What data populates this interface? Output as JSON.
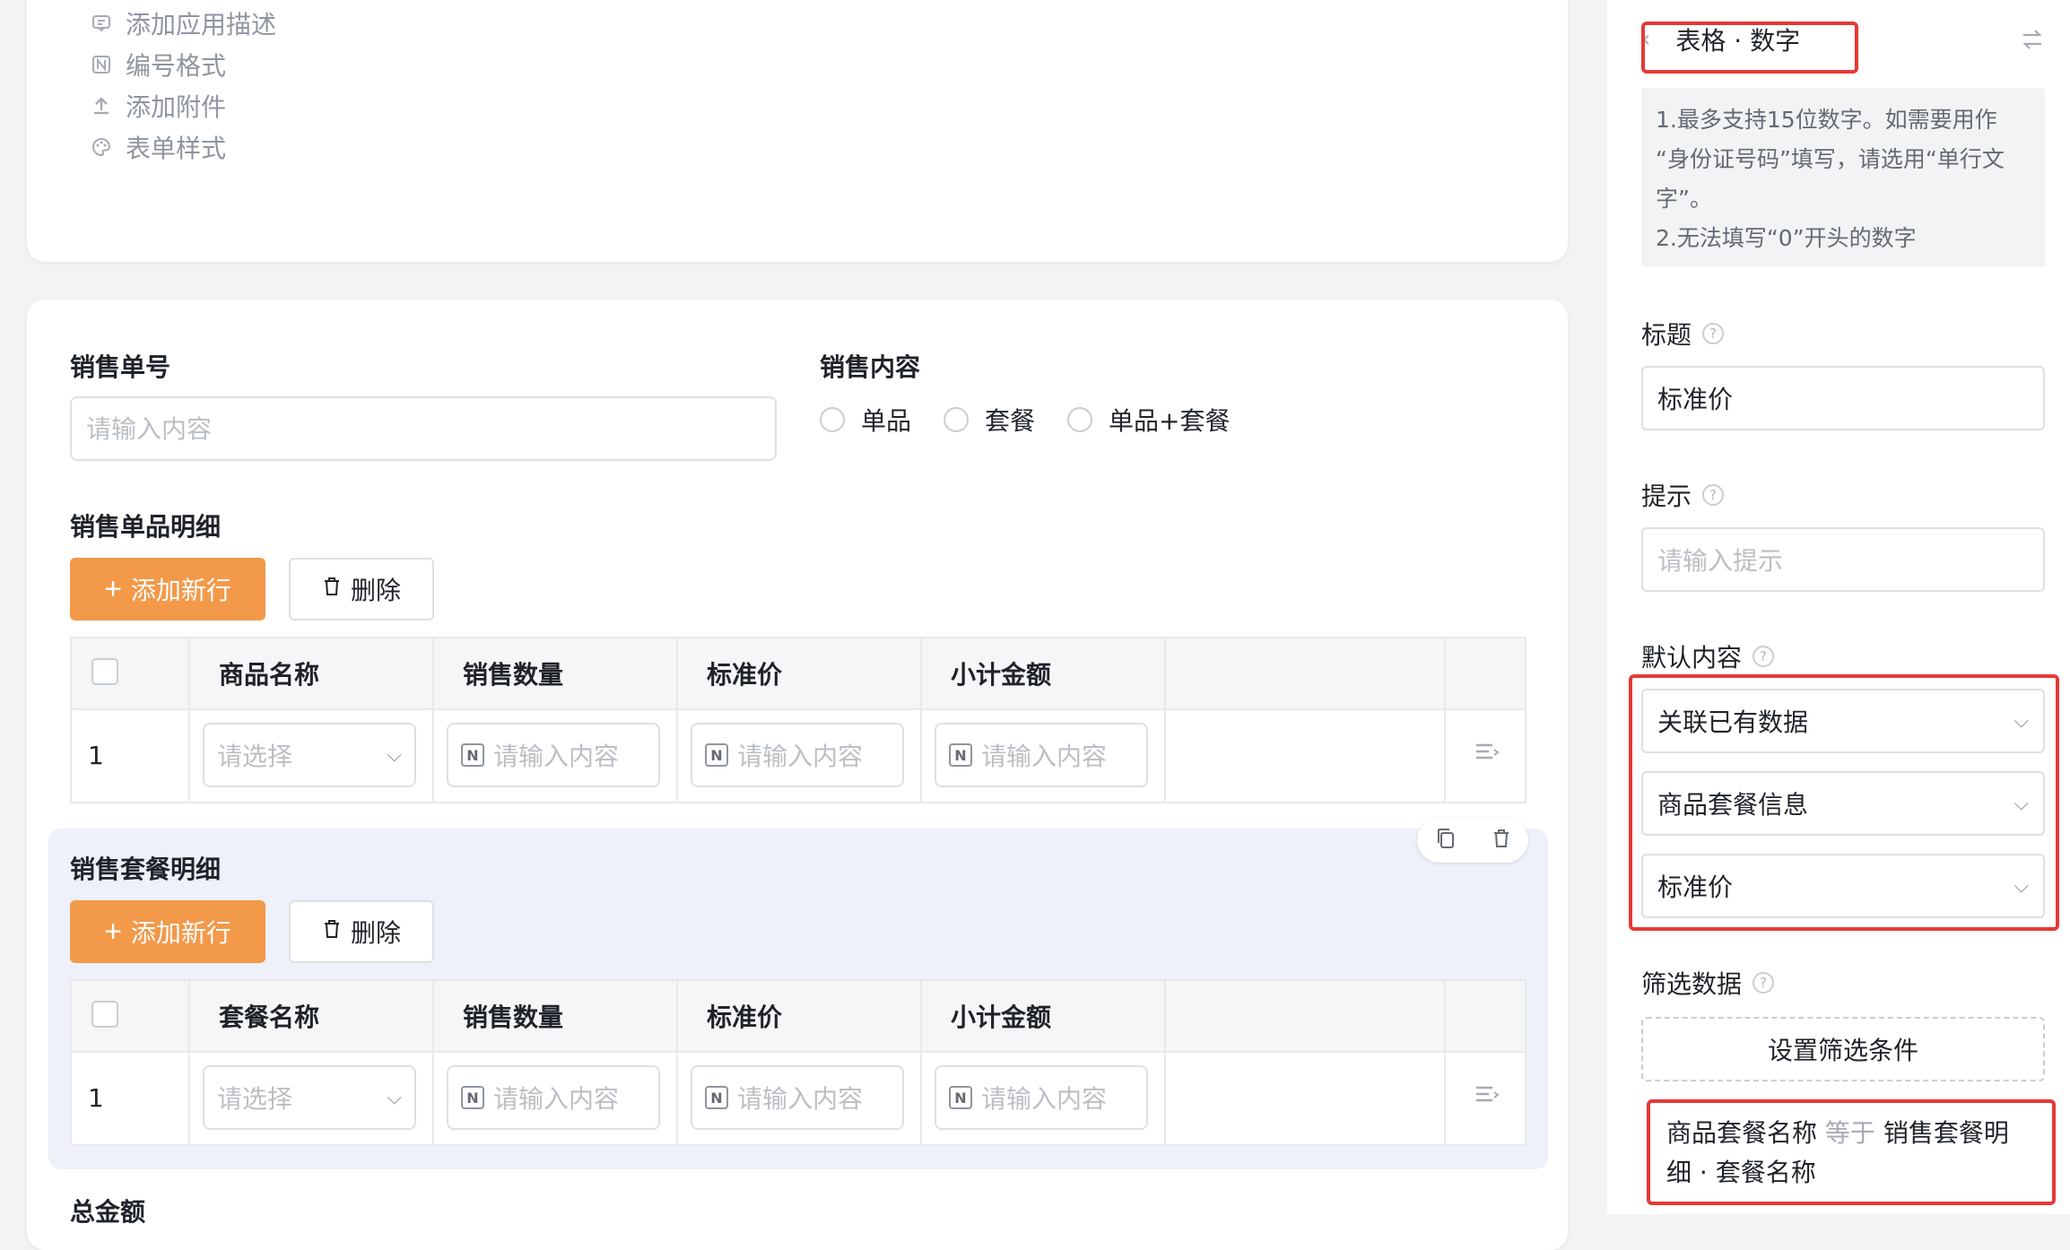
{
  "menu": [
    {
      "label": "添加应用描述",
      "icon": "description-icon"
    },
    {
      "label": "编号格式",
      "icon": "number-format-icon"
    },
    {
      "label": "添加附件",
      "icon": "upload-icon"
    },
    {
      "label": "表单样式",
      "icon": "palette-icon"
    }
  ],
  "form": {
    "sales_no": {
      "label": "销售单号",
      "placeholder": "请输入内容"
    },
    "sales_content": {
      "label": "销售内容",
      "options": [
        "单品",
        "套餐",
        "单品+套餐"
      ]
    },
    "single_detail": {
      "title": "销售单品明细",
      "add_label": "添加新行",
      "delete_label": "删除",
      "columns": [
        "商品名称",
        "销售数量",
        "标准价",
        "小计金额"
      ],
      "row": {
        "index": "1",
        "select_placeholder": "请选择",
        "input_placeholder": "请输入内容"
      }
    },
    "combo_detail": {
      "title": "销售套餐明细",
      "add_label": "添加新行",
      "delete_label": "删除",
      "columns": [
        "套餐名称",
        "销售数量",
        "标准价",
        "小计金额"
      ],
      "row": {
        "index": "1",
        "select_placeholder": "请选择",
        "input_placeholder": "请输入内容"
      }
    },
    "total_label": "总金额"
  },
  "panel": {
    "header": "表格 · 数字",
    "tips": [
      "1.最多支持15位数字。如需要用作",
      "“身份证号码”填写，请选用“单行文",
      "字”。",
      "2.无法填写“0”开头的数字"
    ],
    "title_label": "标题",
    "title_value": "标准价",
    "hint_label": "提示",
    "hint_placeholder": "请输入提示",
    "default_label": "默认内容",
    "default_selects": [
      "关联已有数据",
      "商品套餐信息",
      "标准价"
    ],
    "filter_label": "筛选数据",
    "filter_button": "设置筛选条件",
    "filter_cond": {
      "field": "商品套餐名称",
      "op": "等于",
      "value": "销售套餐明",
      "value2": "细 · 套餐名称"
    }
  },
  "colors": {
    "accent": "#f2994a",
    "highlight": "#e53935",
    "block": "#eef0fa"
  }
}
